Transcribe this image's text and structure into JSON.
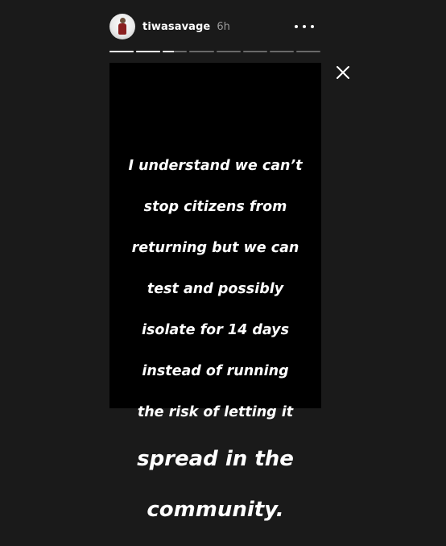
{
  "header": {
    "username": "tiwasavage",
    "time": "6h",
    "avatar_icon": "profile-avatar",
    "more_icon": "more-horizontal-icon"
  },
  "progress": {
    "segments": [
      1,
      1,
      0.45,
      0,
      0,
      0,
      0,
      0
    ],
    "color_active": "#ffffff",
    "color_inactive": "#5a5a5a"
  },
  "close_icon": "close-icon",
  "story": {
    "background": "#000000",
    "lines": [
      "I understand we can’t",
      "stop citizens from",
      "returning but we can",
      "test and possibly",
      "isolate for 14 days",
      "instead of running",
      "the risk of letting it"
    ],
    "big_lines": [
      "spread in the",
      "community."
    ]
  }
}
